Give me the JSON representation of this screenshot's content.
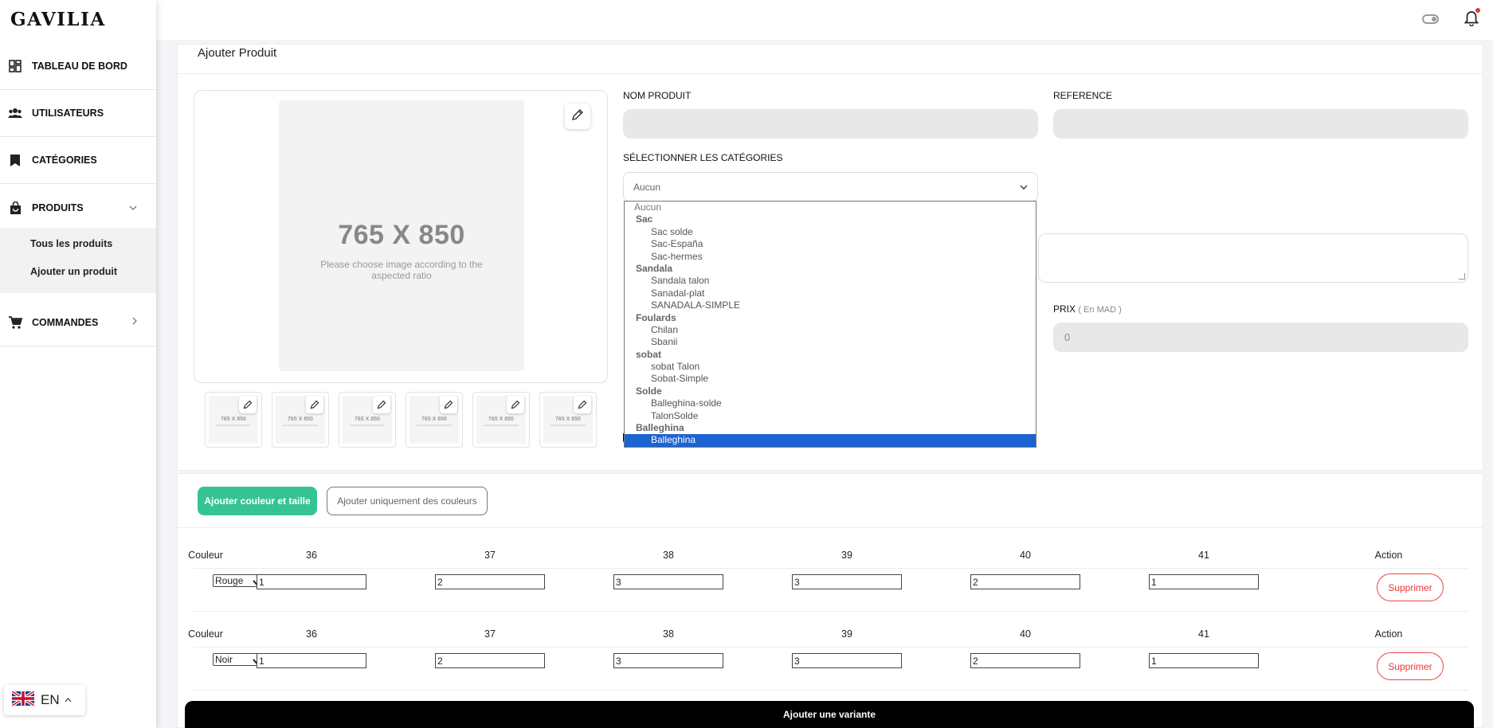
{
  "app": {
    "logo": "GAVILIA"
  },
  "sidebar": {
    "items": [
      {
        "label": "TABLEAU DE BORD",
        "icon": "dashboard-icon"
      },
      {
        "label": "UTILISATEURS",
        "icon": "users-icon"
      },
      {
        "label": "CATÉGORIES",
        "icon": "bookmark-icon"
      },
      {
        "label": "PRODUITS",
        "icon": "shopping-bag-icon"
      },
      {
        "label": "COMMANDES",
        "icon": "cart-icon"
      }
    ],
    "submenu": [
      "Tous les produits",
      "Ajouter un produit"
    ]
  },
  "language": {
    "code": "EN",
    "flag": "uk-flag-icon"
  },
  "page": {
    "title": "Ajouter Produit"
  },
  "image": {
    "dims": "765 X 850",
    "hint": "Please choose image according to the aspected ratio",
    "thumb_dims": "765 X 850"
  },
  "form": {
    "name_label": "NOM PRODUIT",
    "ref_label": "REFERENCE",
    "categories_label": "SÉLECTIONNER LES CATÉGORIES",
    "categories_value": "Aucun",
    "price_label": "PRIX",
    "price_unit": "( En MAD )",
    "price_value": "0"
  },
  "dropdown": {
    "top": "Aucun",
    "groups": [
      {
        "name": "Sac",
        "children": [
          "Sac solde",
          "Sac-España",
          "Sac-hermes"
        ]
      },
      {
        "name": "Sandala",
        "children": [
          "Sandala talon",
          "Sanadal-plat",
          "SANADALA-SIMPLE"
        ]
      },
      {
        "name": "Foulards",
        "children": [
          "Chilan",
          "Sbanii"
        ]
      },
      {
        "name": "sobat",
        "children": [
          "sobat Talon",
          "Sobat-Simple"
        ]
      },
      {
        "name": "Solde",
        "children": [
          "Balleghina-solde",
          "TalonSolde"
        ]
      },
      {
        "name": "Balleghina",
        "children": [
          "Balleghina"
        ]
      }
    ],
    "selected": "Balleghina"
  },
  "variants": {
    "add_color_size_label": "Ajouter couleur et taille",
    "add_colors_only_label": "Ajouter uniquement des couleurs",
    "headers": {
      "color": "Couleur",
      "sizes": [
        "36",
        "37",
        "38",
        "39",
        "40",
        "41"
      ],
      "action": "Action"
    },
    "rows": [
      {
        "color": "Rouge",
        "qty": [
          "1",
          "2",
          "3",
          "3",
          "2",
          "1"
        ],
        "delete_label": "Supprimer"
      },
      {
        "color": "Noir",
        "qty": [
          "1",
          "2",
          "3",
          "3",
          "2",
          "1"
        ],
        "delete_label": "Supprimer"
      }
    ],
    "add_variant_label": "Ajouter une variante"
  },
  "colors": {
    "accent_green": "#35c491",
    "danger": "#e33333",
    "selection_blue": "#1b63d2"
  }
}
